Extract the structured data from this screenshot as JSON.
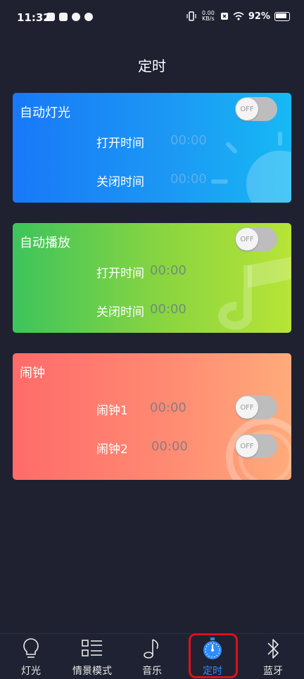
{
  "status_bar": {
    "time": "11:32",
    "speed": "0.00 KB/s",
    "battery": "92%"
  },
  "page_title": "定时",
  "auto_light": {
    "title": "自动灯光",
    "toggle": "OFF",
    "open_label": "打开时间",
    "open_time": "00:00",
    "close_label": "关闭时间",
    "close_time": "00:00"
  },
  "auto_play": {
    "title": "自动播放",
    "toggle": "OFF",
    "open_label": "打开时间",
    "open_time": "00:00",
    "close_label": "关闭时间",
    "close_time": "00:00"
  },
  "alarm": {
    "title": "闹钟",
    "alarm1_label": "闹钟1",
    "alarm1_time": "00:00",
    "alarm1_toggle": "OFF",
    "alarm2_label": "闹钟2",
    "alarm2_time": "00:00",
    "alarm2_toggle": "OFF"
  },
  "tabs": {
    "light": "灯光",
    "scene": "情景模式",
    "music": "音乐",
    "timer": "定时",
    "bluetooth": "蓝牙"
  },
  "colors": {
    "background": "#1f2030",
    "active_tab": "#2e8cff",
    "highlight": "#e0101a"
  }
}
